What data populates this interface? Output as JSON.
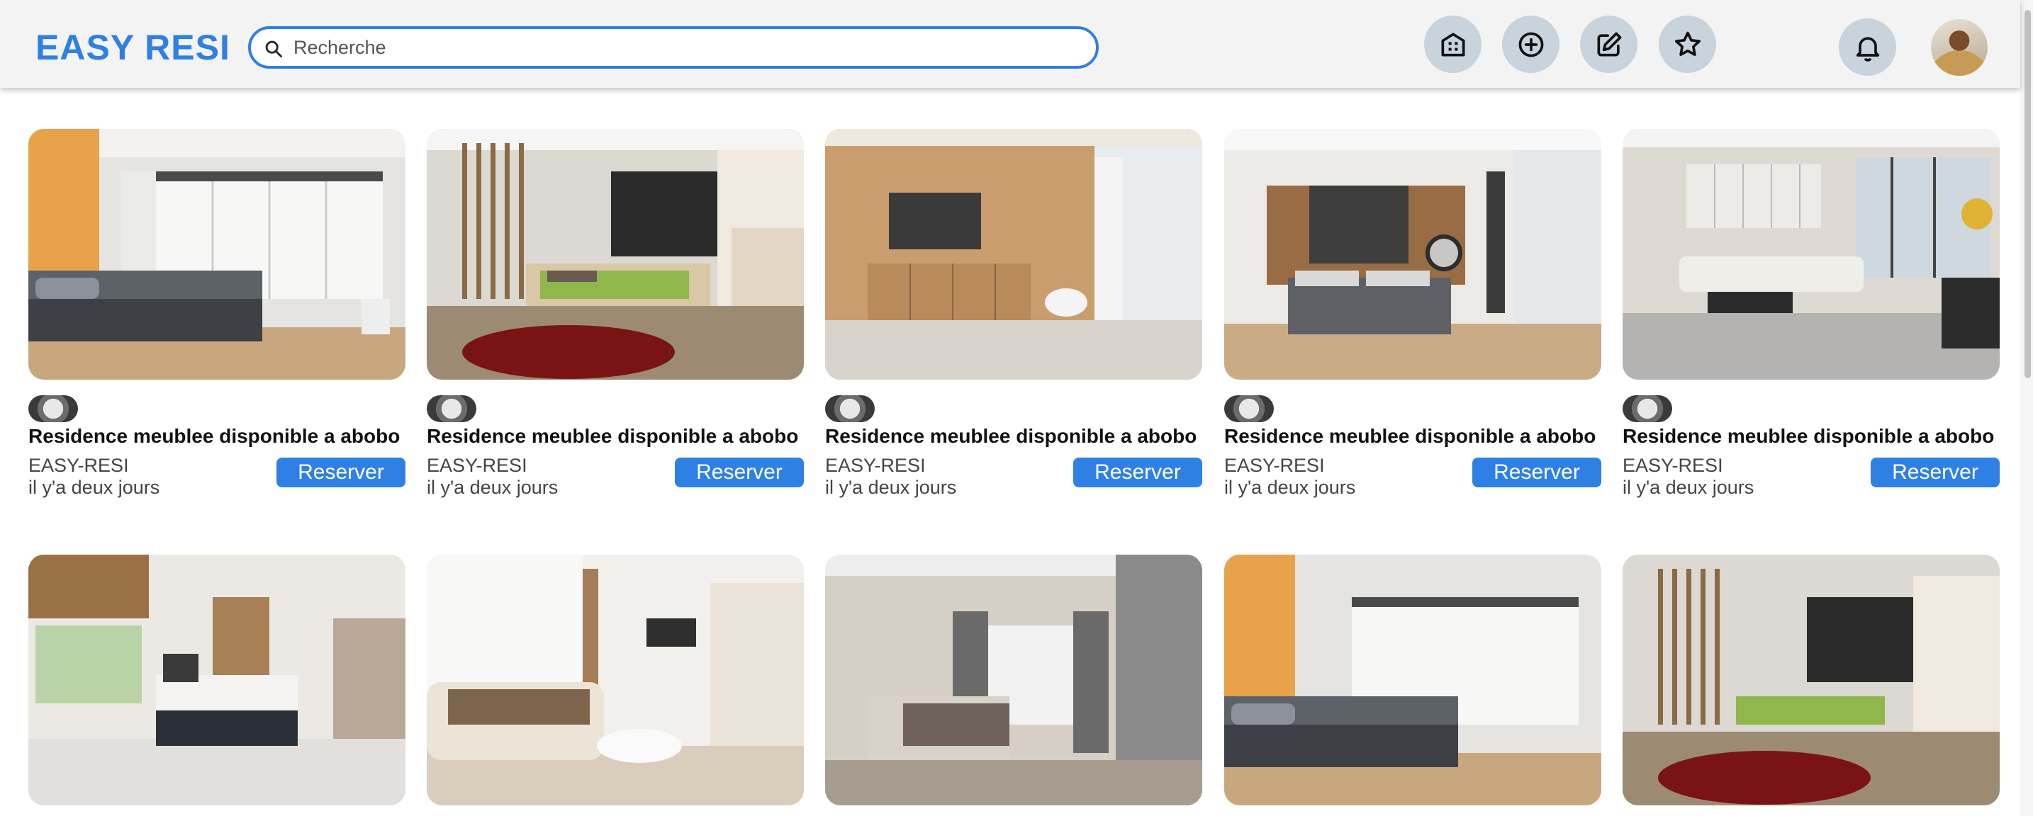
{
  "header": {
    "logo": "EASY RESI",
    "search_placeholder": "Recherche",
    "icons": [
      "building-icon",
      "plus-circle-icon",
      "edit-icon",
      "star-icon",
      "bell-icon"
    ]
  },
  "colors": {
    "brand": "#2f80e4",
    "header_bg": "#f3f3f3",
    "icon_button_bg": "#c8d3dc"
  },
  "listings": [
    {
      "title": "Residence meublee disponible a abobo",
      "author": "EASY-RESI",
      "date": "il y'a deux jours",
      "button": "Reserver",
      "photo": "room-orange-wall-bedroom"
    },
    {
      "title": "Residence meublee disponible a abobo",
      "author": "EASY-RESI",
      "date": "il y'a deux jours",
      "button": "Reserver",
      "photo": "room-green-bed-red-rug"
    },
    {
      "title": "Residence meublee disponible a abobo",
      "author": "EASY-RESI",
      "date": "il y'a deux jours",
      "button": "Reserver",
      "photo": "room-wood-panel-tv"
    },
    {
      "title": "Residence meublee disponible a abobo",
      "author": "EASY-RESI",
      "date": "il y'a deux jours",
      "button": "Reserver",
      "photo": "room-grey-bed-mirror"
    },
    {
      "title": "Residence meublee disponible a abobo",
      "author": "EASY-RESI",
      "date": "il y'a deux jours",
      "button": "Reserver",
      "photo": "room-living-sofa-city"
    }
  ],
  "row2_photos": [
    "room-window-brown-blinds",
    "room-sofa-white-table",
    "room-modern-marble",
    "room-orange-wall-bedroom",
    "room-green-bed-red-rug"
  ]
}
